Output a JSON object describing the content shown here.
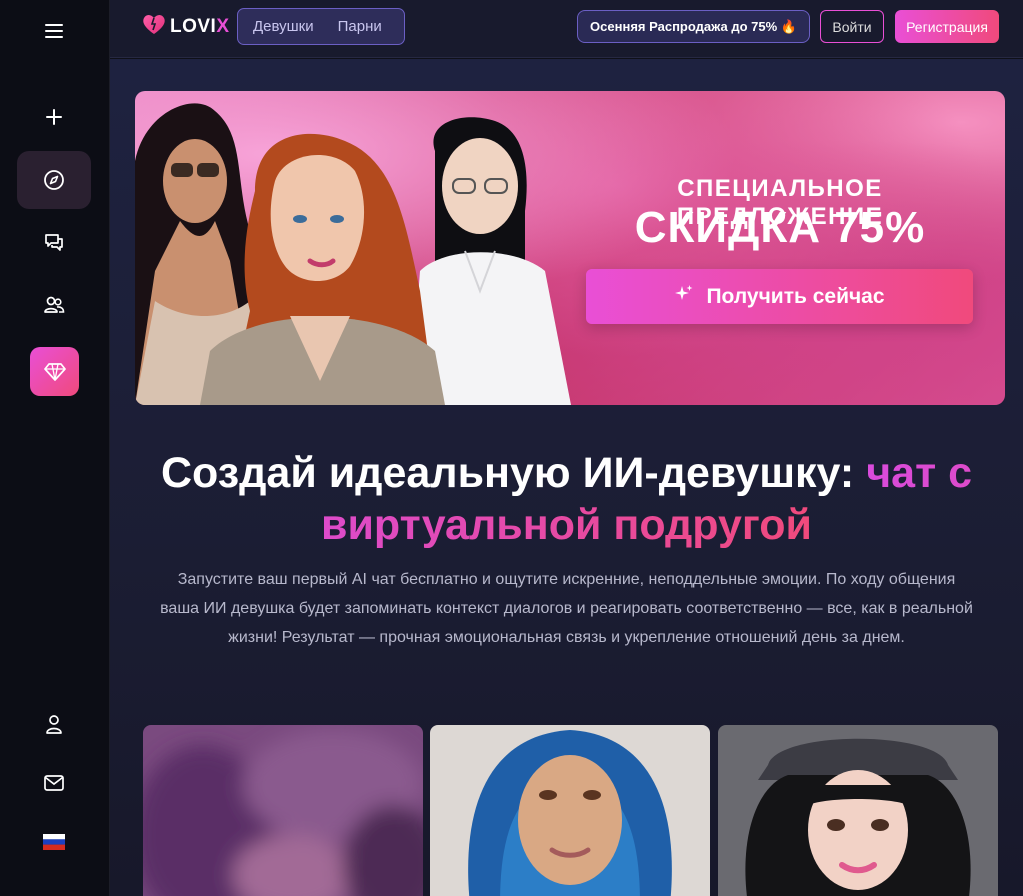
{
  "sidebar": {
    "icons": [
      "menu-icon",
      "plus-icon",
      "compass-icon",
      "chat-icon",
      "users-icon",
      "diamond-icon",
      "user-icon",
      "mail-icon",
      "russian-flag-icon"
    ],
    "accent_colors": [
      "#e94fd6",
      "#f04a7c"
    ]
  },
  "topbar": {
    "logo": {
      "text_main": "LOVI",
      "text_accent": "X"
    },
    "gender_tabs": [
      "Девушки",
      "Парни"
    ],
    "sale": "Осенняя Распродажа до 75% 🔥",
    "login": "Войти",
    "register": "Регистрация"
  },
  "banner": {
    "title": "СПЕЦИАЛЬНОЕ ПРЕДЛОЖЕНИЕ",
    "subtitle": "СКИДКА 75%",
    "cta": "Получить сейчас"
  },
  "hero": {
    "headline_white": "Создай идеальную ИИ-девушку: ",
    "headline_gradient": "чат с виртуальной подругой",
    "description": "Запустите ваш первый AI чат бесплатно и ощутите искренние, неподдельные эмоции. По ходу общения ваша ИИ девушка будет запоминать контекст диалогов и реагировать соответственно — все, как в реальной жизни! Результат — прочная эмоциональная связь и укрепление отношений день за днем."
  },
  "cards": {
    "count": 3
  }
}
